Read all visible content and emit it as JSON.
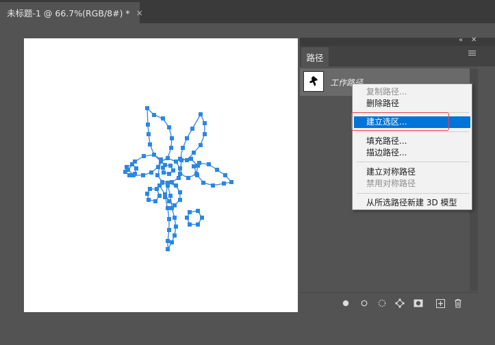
{
  "document_tab": {
    "title": "未标题-1 @ 66.7%(RGB/8#) *",
    "close_glyph": "×"
  },
  "panel": {
    "tab_label": "路径",
    "collapse_glyph": "«",
    "close_glyph": "✕",
    "path_item": {
      "name": "工作路径"
    },
    "bottom_icons": [
      "fill-path-icon",
      "stroke-path-icon",
      "load-selection-icon",
      "make-work-path-icon",
      "add-mask-icon",
      "new-path-icon",
      "delete-path-icon"
    ]
  },
  "context_menu": {
    "items": [
      {
        "label": "复制路径...",
        "enabled": false
      },
      {
        "label": "删除路径",
        "enabled": true
      },
      {
        "label": "建立选区...",
        "enabled": true,
        "highlighted": true
      },
      {
        "label": "填充路径...",
        "enabled": true
      },
      {
        "label": "描边路径...",
        "enabled": true
      },
      {
        "label": "建立对称路径",
        "enabled": true
      },
      {
        "label": "禁用对称路径",
        "enabled": false
      },
      {
        "label": "从所选路径新建 3D 模型",
        "enabled": true
      }
    ]
  },
  "colors": {
    "path_blue": "#2b86e6",
    "highlight": "#0074d8",
    "annotation_red": "#e8434f",
    "workspace": "#535353",
    "canvas": "#ffffff"
  }
}
